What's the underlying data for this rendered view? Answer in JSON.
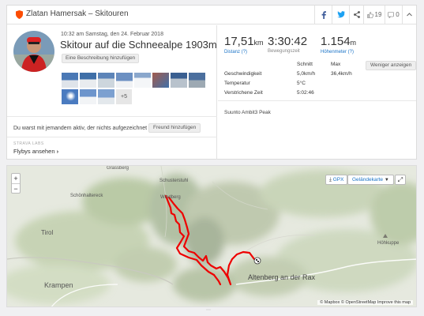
{
  "header": {
    "title": "Zlatan Hamersak – Skitouren",
    "kudos_count": "19",
    "comments_count": "0",
    "icons": [
      "shield-icon",
      "facebook-icon",
      "twitter-icon",
      "share-icon",
      "thumbs-up-icon",
      "comment-icon",
      "chevron-up-icon"
    ],
    "colors": {
      "strava_orange": "#fc4c02",
      "facebook": "#3b5998",
      "twitter": "#1da1f2",
      "link": "#1a73c7",
      "route": "#ee0000"
    }
  },
  "activity": {
    "datetime": "10:32 am Samstag, den 24. Februar 2018",
    "title": "Skitour auf die Schneealpe 1903m",
    "add_description_label": "Eine Beschreibung hinzufügen",
    "photos_more_label": "+5",
    "with_someone_question": "Du warst mit jemandem aktiv, der nichts aufgezeichnet hat?",
    "add_friend_label": "Freund hinzufügen",
    "labs_label": "STRAVA LABS",
    "flybys_label": "Flybys ansehen"
  },
  "stats": {
    "distance": {
      "value": "17,51",
      "unit": "km",
      "label": "Distanz (?)"
    },
    "moving_time": {
      "value": "3:30:42",
      "label": "Bewegungszeit"
    },
    "elevation": {
      "value": "1.154",
      "unit": "m",
      "label": "Höhenmeter (?)"
    },
    "table_headers": {
      "avg": "Schnitt",
      "max": "Max"
    },
    "rows": [
      {
        "label": "Geschwindigkeit",
        "avg": "5,0km/h",
        "max": "36,4km/h"
      },
      {
        "label": "Temperatur",
        "avg": "5°C",
        "max": ""
      },
      {
        "label": "Verstrichene Zeit",
        "avg": "5:02:46",
        "max": ""
      }
    ],
    "show_less_label": "Weniger anzeigen",
    "device": "Suunto Ambit3 Peak"
  },
  "map": {
    "zoom_in": "+",
    "zoom_out": "−",
    "gpx_label": "GPX",
    "map_type_label": "Geländekarte",
    "attribution": "© Mapbox © OpenStreetMap Improve this map",
    "place_labels": {
      "schusterstuhl": "Schusterstuhl",
      "schoenhaltereck": "Schönhaltereck",
      "windberg": "Windberg",
      "tirol": "Tirol",
      "krampen": "Krampen",
      "altenberg": "Altenberg an der Rax",
      "hoehkuppe": "Höhkuppe",
      "grassberg": "Grassberg"
    }
  }
}
